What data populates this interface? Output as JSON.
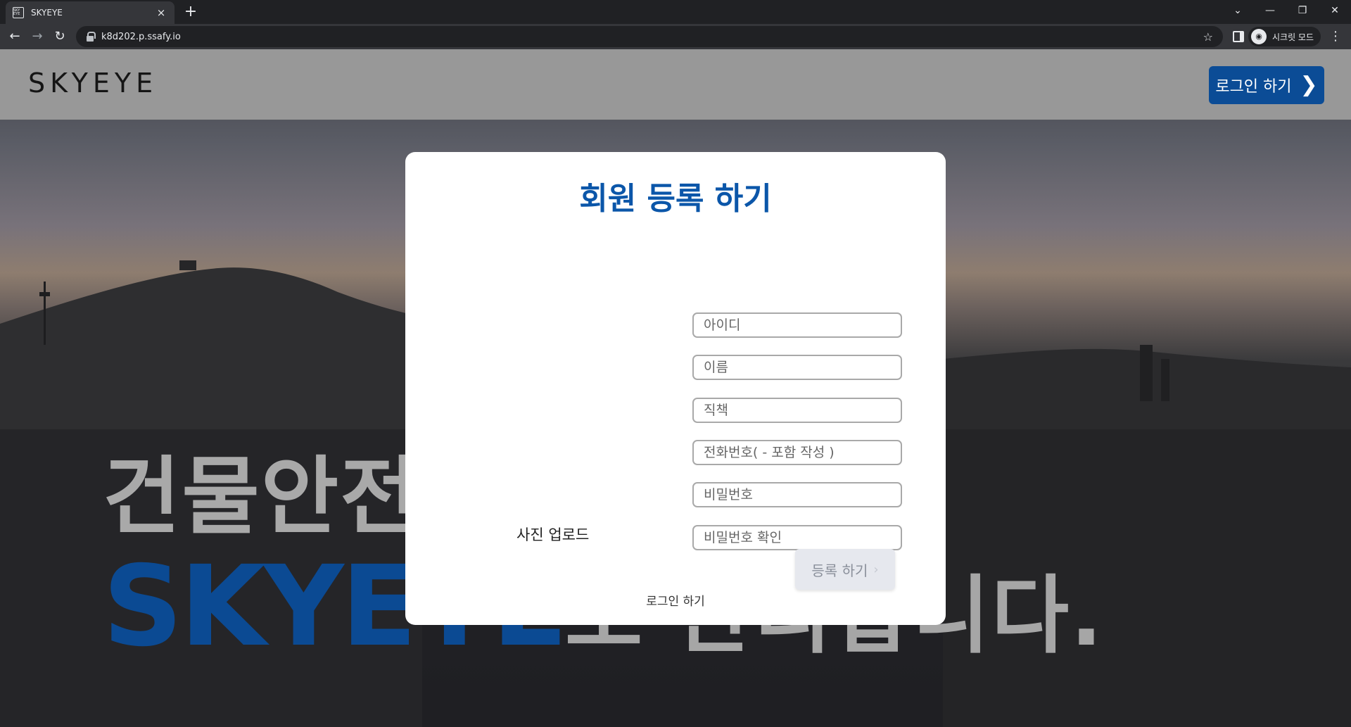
{
  "browser": {
    "tab_title": "SKYEYE",
    "favicon_text": "SKY EYE",
    "tab_close": "×",
    "new_tab": "+",
    "url": "k8d202.p.ssafy.io",
    "incognito_label": "시크릿 모드",
    "window_controls": {
      "dropdown": "⌄",
      "minimize": "—",
      "restore": "❐",
      "close": "✕"
    }
  },
  "header": {
    "brand": "SKYEYE",
    "login_button": "로그인 하기",
    "login_chevron": "❯"
  },
  "hero": {
    "line1": "건물안전",
    "line2_brand": "SKYEYE",
    "line2_rest": "로 관리합니다."
  },
  "modal": {
    "title": "회원 등록 하기",
    "fields": {
      "id": "아이디",
      "name": "이름",
      "position": "직책",
      "phone": "전화번호( - 포함 작성 )",
      "password": "비밀번호",
      "password_confirm": "비밀번호 확인"
    },
    "photo_upload": "사진 업로드",
    "submit": "등록 하기",
    "submit_chevron": "›",
    "login_link": "로그인 하기"
  },
  "colors": {
    "brand_blue": "#0b4c96",
    "title_blue": "#0b56a9",
    "header_gray": "#989898"
  }
}
